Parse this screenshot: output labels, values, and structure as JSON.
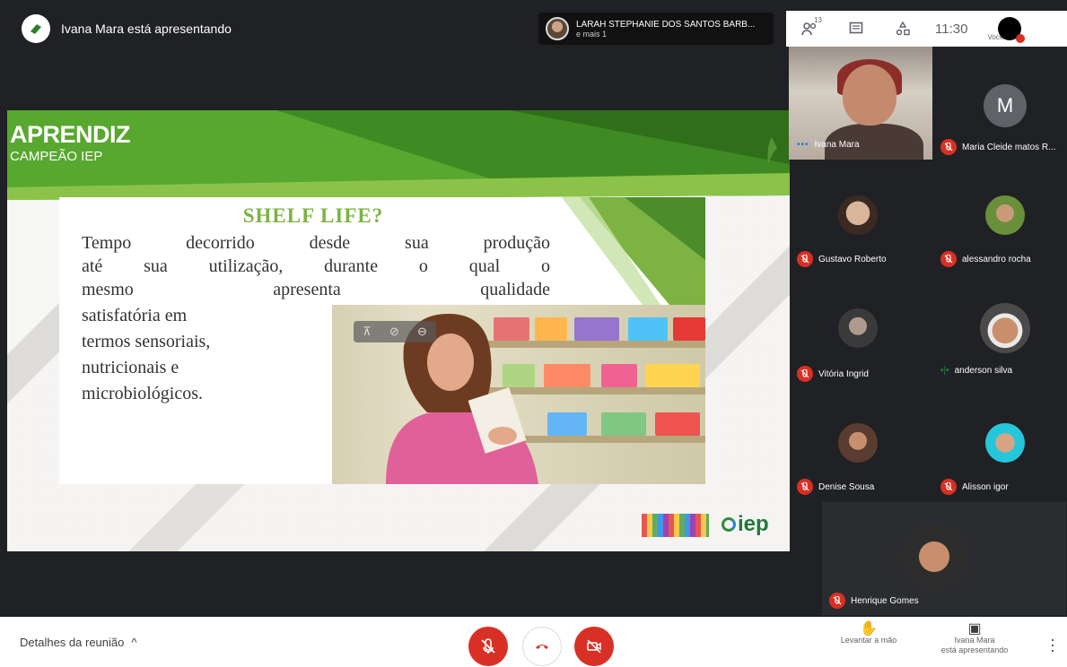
{
  "presenter_bar": {
    "text": "Ivana Mara está apresentando"
  },
  "speaker": {
    "name": "LARAH STEPHANIE DOS SANTOS BARB...",
    "more": "e mais 1"
  },
  "top_controls": {
    "participants_count": "13",
    "time": "11:30",
    "you_label": "Você"
  },
  "slide": {
    "brand_main": "APRENDIZ",
    "brand_sub": "CAMPEÃO IEP",
    "title": "SHELF LIFE?",
    "paragraph_lines": [
      "Tempo decorrido desde sua produção",
      "até sua utilização, durante o qual o",
      "mesmo apresenta qualidade"
    ],
    "bullet_lines": [
      "satisfatória em",
      "termos sensoriais,",
      "nutricionais e",
      "microbiológicos."
    ],
    "logo_text": "iep"
  },
  "participants": [
    {
      "name": "Ivana Mara",
      "status": "speaking"
    },
    {
      "name": "Maria Cleide matos R...",
      "status": "muted",
      "initial": "M"
    },
    {
      "name": "Gustavo Roberto",
      "status": "muted"
    },
    {
      "name": "alessandro rocha",
      "status": "muted"
    },
    {
      "name": "Vitória Ingrid",
      "status": "muted"
    },
    {
      "name": "anderson silva",
      "status": "speaking"
    },
    {
      "name": "Denise Sousa",
      "status": "muted"
    },
    {
      "name": "Alisson igor",
      "status": "muted"
    },
    {
      "name": "Henrique Gomes",
      "status": "muted"
    }
  ],
  "bottom_bar": {
    "details_label": "Detalhes da reunião",
    "raise_hand_label": "Levantar a mão",
    "presenting_line1": "Ivana Mara",
    "presenting_line2": "está apresentando"
  },
  "colors": {
    "accent_red": "#d93025",
    "slide_green": "#7cb342",
    "background": "#202124"
  }
}
